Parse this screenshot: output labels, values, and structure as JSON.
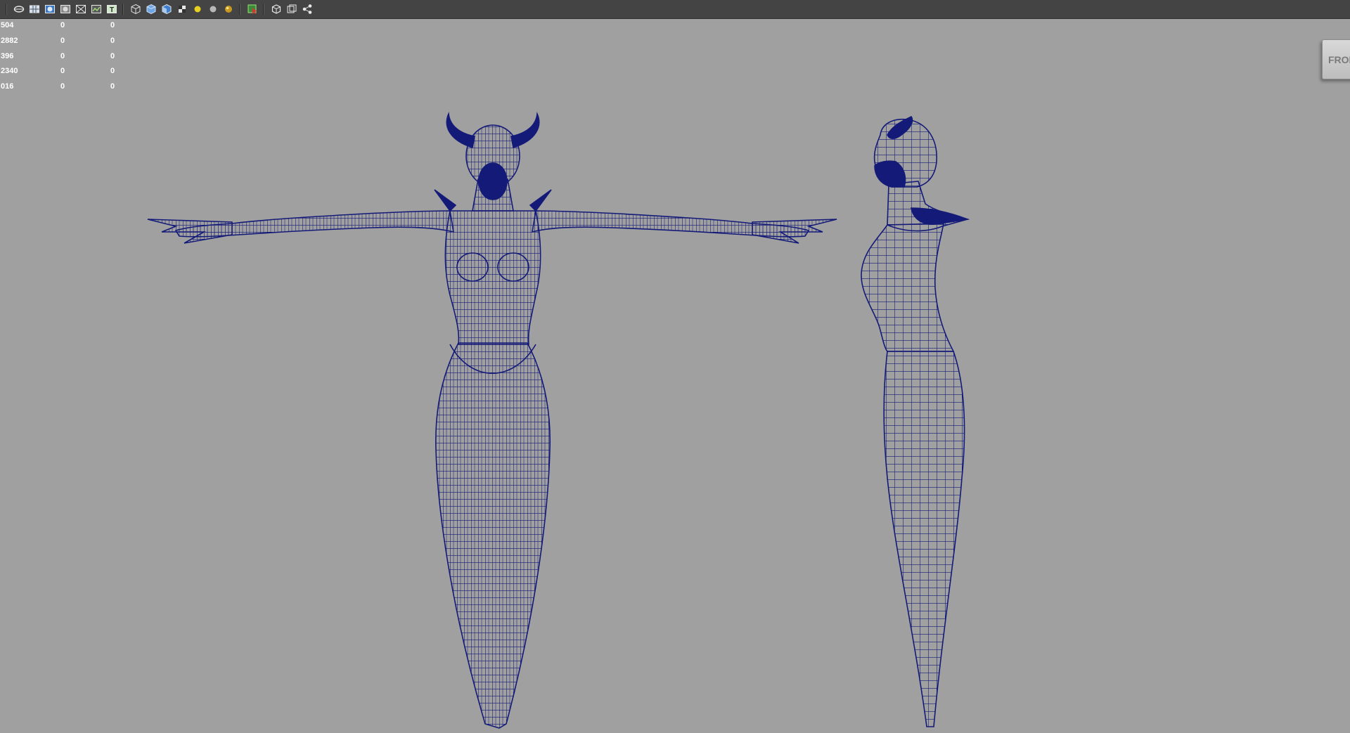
{
  "toolbar": {
    "icons": [
      "wireframe-shade-icon",
      "grid-panel-icon",
      "shaded-sphere-icon",
      "flat-shade-icon",
      "xray-icon",
      "texture-map-icon",
      "text-overlay-icon",
      "cube-wire-icon",
      "cube-smooth-icon",
      "cube-shaded-icon",
      "checker-icon",
      "yellow-light-icon",
      "gray-light-icon",
      "gold-light-icon",
      "select-tool-icon",
      "isolate-cube-icon",
      "frame-all-icon",
      "share-nodes-icon"
    ],
    "text_icon_label": "T"
  },
  "hud": {
    "rows": [
      [
        "504",
        "0",
        "0"
      ],
      [
        "2882",
        "0",
        "0"
      ],
      [
        "396",
        "0",
        "0"
      ],
      [
        "2340",
        "0",
        "0"
      ],
      [
        "016",
        "0",
        "0"
      ]
    ]
  },
  "viewcube": {
    "label": "FRONT"
  },
  "colors": {
    "background": "#a0a0a0",
    "wireframe": "#141a78",
    "toolbar": "#444444"
  },
  "models": {
    "front": "front-view-wireframe",
    "side": "side-view-wireframe"
  }
}
